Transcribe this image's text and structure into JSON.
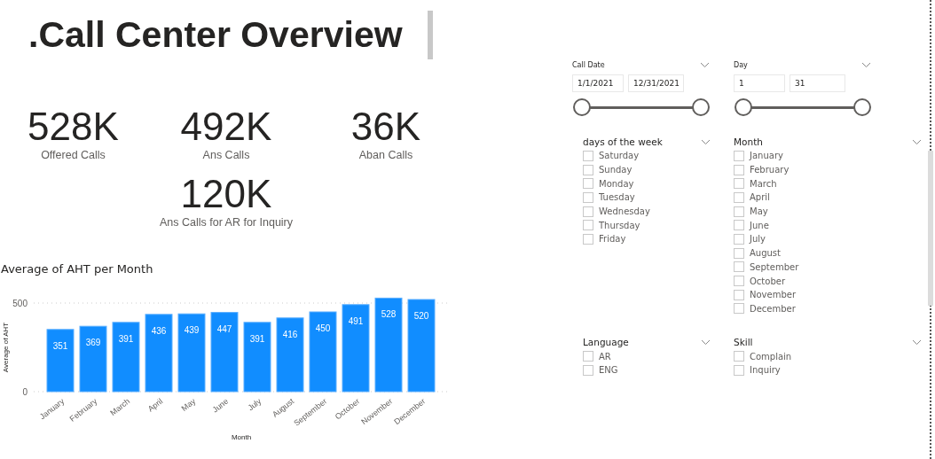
{
  "title": ".Call Center Overview",
  "kpis": [
    {
      "value": "528K",
      "label": "Offered Calls"
    },
    {
      "value": "492K",
      "label": "Ans Calls"
    },
    {
      "value": "36K",
      "label": "Aban Calls"
    },
    {
      "value": "120K",
      "label": "Ans Calls for AR for Inquiry"
    }
  ],
  "chart": {
    "chart_data": {
      "type": "bar",
      "title": "Average of AHT per Month",
      "xlabel": "Month",
      "ylabel": "Average of AHT",
      "categories": [
        "January",
        "February",
        "March",
        "April",
        "May",
        "June",
        "July",
        "August",
        "September",
        "October",
        "November",
        "December"
      ],
      "values": [
        351,
        369,
        391,
        436,
        439,
        447,
        391,
        416,
        450,
        491,
        528,
        520
      ],
      "yticks": [
        0,
        500
      ],
      "ylim": [
        0,
        530
      ],
      "data_labels": true
    }
  },
  "range_slicers": [
    {
      "title": "Call Date",
      "from": "1/1/2021",
      "to": "12/31/2021",
      "thumbs": [
        {
          "level": 0
        },
        {
          "level": 1
        }
      ]
    },
    {
      "title": "Day",
      "from": "1",
      "to": "31",
      "thumbs": [
        {
          "level": 0
        },
        {
          "level": 1
        }
      ]
    }
  ],
  "list_slicers": [
    {
      "title": "days of the week",
      "items": [
        {
          "label": "Saturday",
          "checked": false
        },
        {
          "label": "Sunday",
          "checked": false
        },
        {
          "label": "Monday",
          "checked": false
        },
        {
          "label": "Tuesday",
          "checked": false
        },
        {
          "label": "Wednesday",
          "checked": false
        },
        {
          "label": "Thursday",
          "checked": false
        },
        {
          "label": "Friday",
          "checked": false
        }
      ]
    },
    {
      "title": "Month",
      "items": [
        {
          "label": "January",
          "checked": false
        },
        {
          "label": "February",
          "checked": false
        },
        {
          "label": "March",
          "checked": false
        },
        {
          "label": "April",
          "checked": false
        },
        {
          "label": "May",
          "checked": false
        },
        {
          "label": "June",
          "checked": false
        },
        {
          "label": "July",
          "checked": false
        },
        {
          "label": "August",
          "checked": false
        },
        {
          "label": "September",
          "checked": false
        },
        {
          "label": "October",
          "checked": false
        },
        {
          "label": "November",
          "checked": false
        },
        {
          "label": "December",
          "checked": false
        }
      ]
    },
    {
      "title": "Language",
      "items": [
        {
          "label": "AR",
          "checked": false
        },
        {
          "label": "ENG",
          "checked": false
        }
      ]
    },
    {
      "title": "Skill",
      "items": [
        {
          "label": "Complain",
          "checked": false
        },
        {
          "label": "Inquiry",
          "checked": false
        }
      ]
    }
  ]
}
